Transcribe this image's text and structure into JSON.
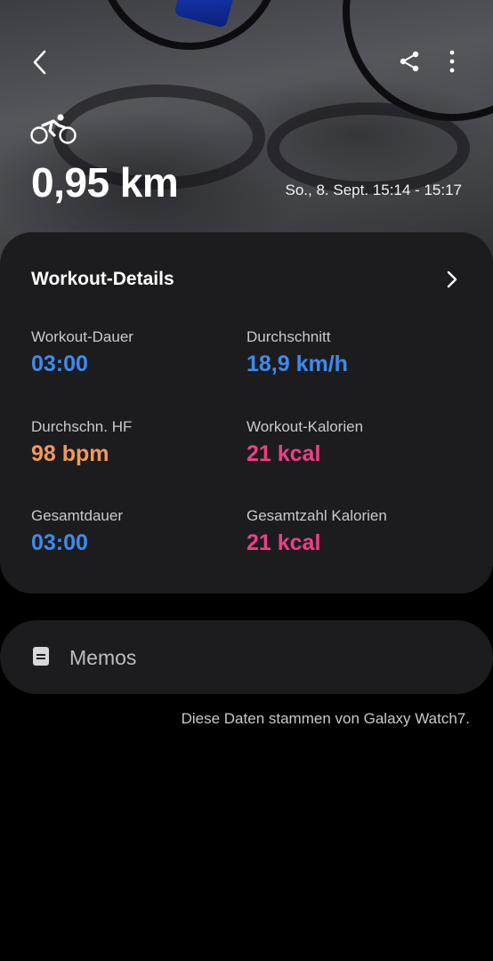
{
  "header": {
    "back_icon": "chevron-left-icon",
    "share_icon": "share-icon",
    "more_icon": "more-vertical-icon",
    "activity_icon": "cycling-icon"
  },
  "summary": {
    "distance": "0,95 km",
    "date_range": "So., 8. Sept. 15:14 - 15:17"
  },
  "details": {
    "title": "Workout-Details",
    "stats": [
      {
        "label": "Workout-Dauer",
        "value": "03:00",
        "color": "#3d8bef"
      },
      {
        "label": "Durchschnitt",
        "value": "18,9 km/h",
        "color": "#3d8bef"
      },
      {
        "label": "Durchschn. HF",
        "value": "98 bpm",
        "color": "#f2995a"
      },
      {
        "label": "Workout-Kalorien",
        "value": "21 kcal",
        "color": "#ee3f86"
      },
      {
        "label": "Gesamtdauer",
        "value": "03:00",
        "color": "#3d8bef"
      },
      {
        "label": "Gesamtzahl Kalorien",
        "value": "21 kcal",
        "color": "#ee3f86"
      }
    ]
  },
  "memos": {
    "label": "Memos"
  },
  "footer": {
    "source_note": "Diese Daten stammen von Galaxy Watch7."
  }
}
